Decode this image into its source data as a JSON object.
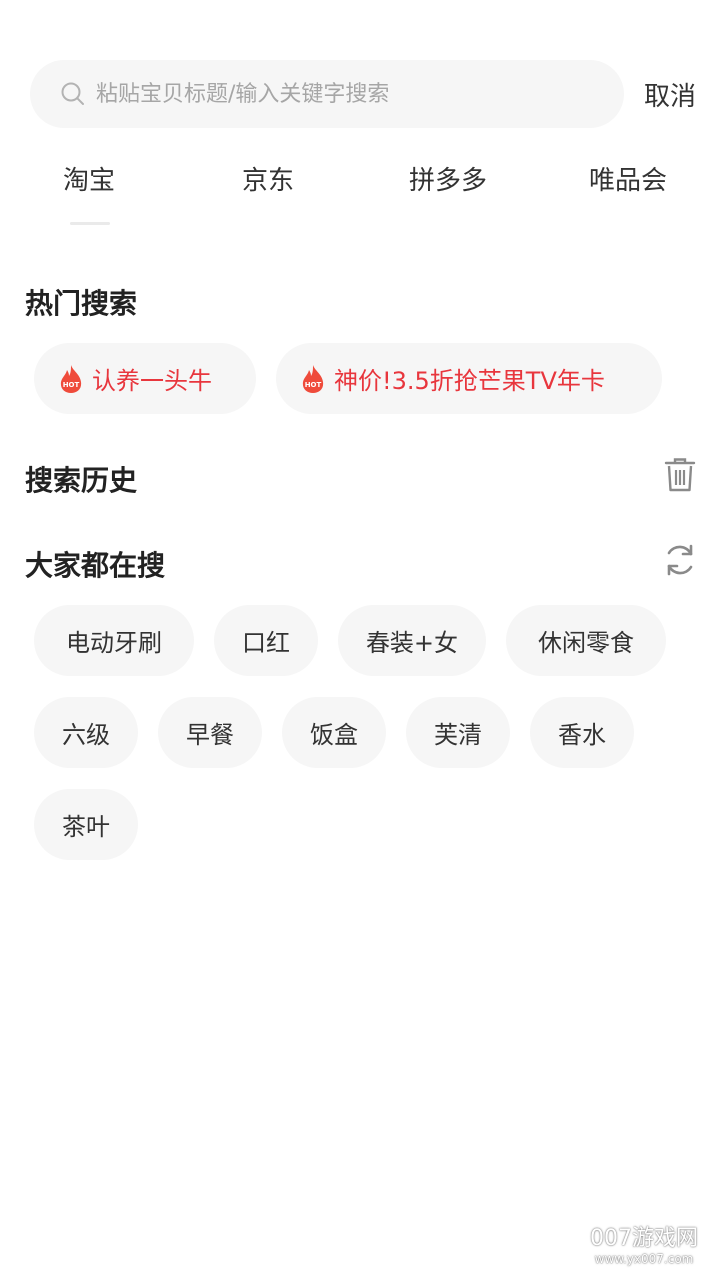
{
  "search": {
    "placeholder": "粘贴宝贝标题/输入关键字搜索",
    "cancel_label": "取消"
  },
  "tabs": [
    {
      "label": "淘宝",
      "active": true
    },
    {
      "label": "京东",
      "active": false
    },
    {
      "label": "拼多多",
      "active": false
    },
    {
      "label": "唯品会",
      "active": false
    }
  ],
  "hot_search": {
    "title": "热门搜索",
    "badge_text": "HOT",
    "items": [
      {
        "label": "认养一头牛"
      },
      {
        "label": "神价!3.5折抢芒果TV年卡"
      }
    ]
  },
  "history": {
    "title": "搜索历史",
    "clear_icon": "trash-icon"
  },
  "popular": {
    "title": "大家都在搜",
    "refresh_icon": "refresh-icon",
    "items": [
      {
        "label": "电动牙刷"
      },
      {
        "label": "口红"
      },
      {
        "label": "春装+女"
      },
      {
        "label": "休闲零食"
      },
      {
        "label": "六级"
      },
      {
        "label": "早餐"
      },
      {
        "label": "饭盒"
      },
      {
        "label": "芙清"
      },
      {
        "label": "香水"
      },
      {
        "label": "茶叶"
      }
    ]
  },
  "watermark": {
    "text": "007游戏网",
    "url": "www.yx007.com"
  },
  "colors": {
    "accent_red": "#e8363d",
    "chip_bg": "#f6f6f6",
    "text_main": "#333333",
    "placeholder": "#a6a6a6"
  }
}
